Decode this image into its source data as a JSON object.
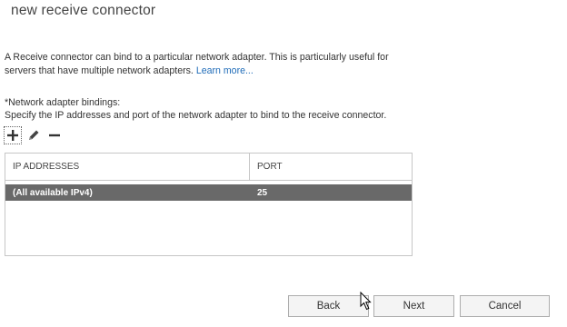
{
  "dialog": {
    "title": "new receive connector",
    "description": "A Receive connector can bind to a particular network adapter. This is particularly useful for servers that have multiple network adapters.",
    "learn_more": "Learn more..."
  },
  "bindings": {
    "label": "*Network adapter bindings:",
    "hint": "Specify the IP addresses and port of the network adapter to bind to the receive connector.",
    "toolbar": {
      "add_icon": "plus-icon",
      "edit_icon": "pencil-icon",
      "remove_icon": "minus-icon"
    },
    "columns": [
      "IP ADDRESSES",
      "PORT"
    ],
    "rows": [
      {
        "ip": "(All available IPv4)",
        "port": "25",
        "selected": true
      }
    ]
  },
  "footer": {
    "back_label": "Back",
    "next_label": "Next",
    "cancel_label": "Cancel"
  },
  "colors": {
    "link": "#1e6bb8",
    "selected_row": "#696969",
    "border": "#c6c6c6",
    "button_bg": "#f4f4f4"
  }
}
